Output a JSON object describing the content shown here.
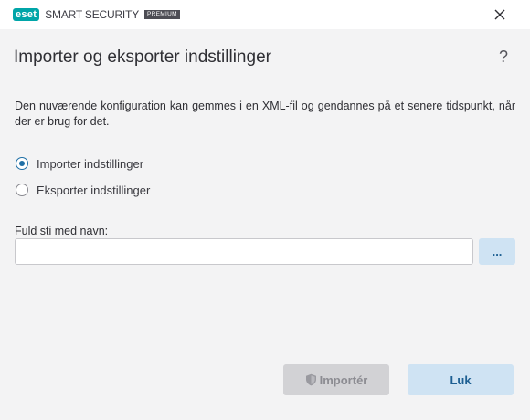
{
  "window": {
    "brand_logo_text": "eset",
    "product_name": "SMART SECURITY",
    "edition_badge": "PREMIUM",
    "close_icon": "close-icon"
  },
  "dialog": {
    "title": "Importer og eksporter indstillinger",
    "help_label": "?",
    "description": "Den nuværende konfiguration kan gemmes i en XML-fil og gendannes på et senere tidspunkt, når der er brug for det.",
    "options": [
      {
        "label": "Importer indstillinger",
        "selected": true
      },
      {
        "label": "Eksporter indstillinger",
        "selected": false
      }
    ],
    "path_field": {
      "label": "Fuld sti med navn:",
      "value": "",
      "placeholder": ""
    },
    "browse_label": "...",
    "import_button": {
      "label": "Importér",
      "icon": "shield-icon",
      "enabled": false
    },
    "close_button_label": "Luk"
  },
  "colors": {
    "accent": "#1f6fa6",
    "brand": "#00a5a8",
    "button_bg": "#cfe3f3",
    "button_text": "#1d5f92",
    "disabled_bg": "#d2d2d5",
    "disabled_text": "#8c8c92",
    "background": "#f3f3f4"
  }
}
